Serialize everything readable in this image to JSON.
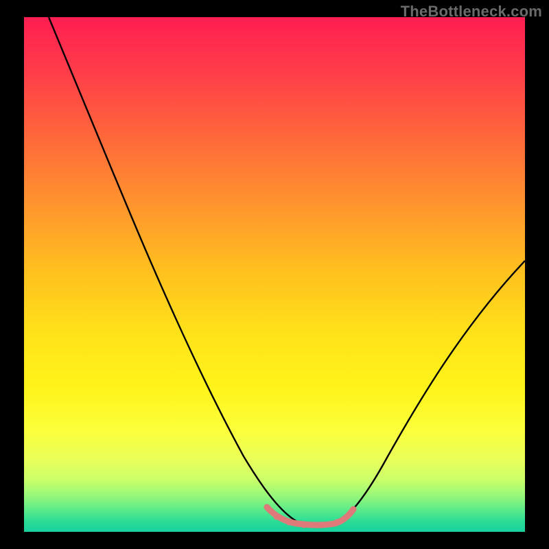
{
  "watermark": "TheBottleneck.com",
  "chart_data": {
    "type": "line",
    "title": "",
    "xlabel": "",
    "ylabel": "",
    "xlim": [
      0,
      100
    ],
    "ylim": [
      0,
      100
    ],
    "grid": false,
    "legend": false,
    "background_gradient": {
      "direction": "vertical",
      "stops": [
        {
          "pos": 0,
          "color": "#ff1e52"
        },
        {
          "pos": 0.5,
          "color": "#ffc21e"
        },
        {
          "pos": 0.8,
          "color": "#fcff3a"
        },
        {
          "pos": 1.0,
          "color": "#18cf9f"
        }
      ]
    },
    "series": [
      {
        "name": "curve",
        "color": "#000000",
        "stroke_width": 2,
        "x": [
          5,
          10,
          15,
          20,
          25,
          30,
          35,
          40,
          45,
          48,
          52,
          55,
          58,
          62,
          65,
          70,
          75,
          80,
          85,
          90,
          95,
          100
        ],
        "y": [
          100,
          91,
          82,
          73,
          63,
          53,
          43,
          33,
          22,
          14,
          6,
          3,
          2,
          2,
          3,
          7,
          13,
          20,
          28,
          36,
          44,
          52
        ]
      },
      {
        "name": "flat-bottom-highlight",
        "color": "#e17a7a",
        "stroke_width": 6,
        "x": [
          48,
          50,
          53,
          56,
          59,
          62,
          64
        ],
        "y": [
          5,
          3,
          2,
          2,
          2,
          3,
          5
        ]
      }
    ],
    "annotations": []
  },
  "colors": {
    "frame": "#000000",
    "curve": "#000000",
    "highlight": "#e17a7a",
    "watermark": "#6a6a6a"
  }
}
